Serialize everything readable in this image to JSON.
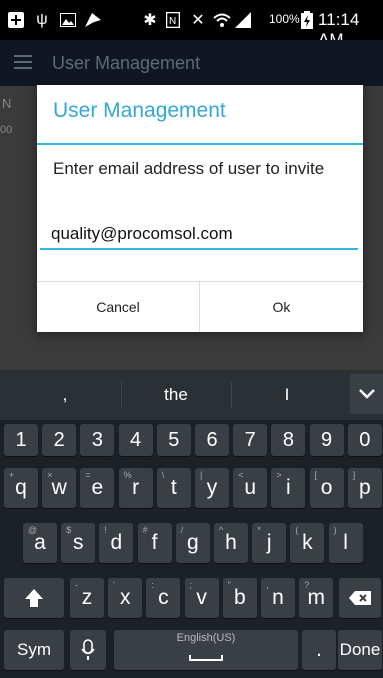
{
  "status_bar": {
    "icons": [
      "add-icon",
      "usb-icon",
      "image-icon",
      "speed-icon",
      "bluetooth-icon",
      "nfc-icon",
      "mute-icon",
      "wifi-icon",
      "signal-icon",
      "battery-icon"
    ],
    "battery_pct": "100%",
    "time": "11:14 AM"
  },
  "app": {
    "title": "User Management",
    "column_header": "N",
    "row_value": "00"
  },
  "dialog": {
    "title": "User Management",
    "message": "Enter email address of user to invite",
    "email_value": "quality@procomsol.com",
    "cancel_label": "Cancel",
    "ok_label": "Ok",
    "accent_color": "#33b5e5"
  },
  "keyboard": {
    "suggestions": [
      ",",
      "the",
      "I"
    ],
    "number_row": [
      "1",
      "2",
      "3",
      "4",
      "5",
      "6",
      "7",
      "8",
      "9",
      "0"
    ],
    "row1": [
      {
        "key": "q",
        "sub": "+"
      },
      {
        "key": "w",
        "sub": "×"
      },
      {
        "key": "e",
        "sub": "="
      },
      {
        "key": "r",
        "sub": "%"
      },
      {
        "key": "t",
        "sub": "\\"
      },
      {
        "key": "y",
        "sub": "|"
      },
      {
        "key": "u",
        "sub": "<"
      },
      {
        "key": "i",
        "sub": ">"
      },
      {
        "key": "o",
        "sub": "["
      },
      {
        "key": "p",
        "sub": "]"
      }
    ],
    "row2": [
      {
        "key": "a",
        "sub": "@"
      },
      {
        "key": "s",
        "sub": "$"
      },
      {
        "key": "d",
        "sub": "!"
      },
      {
        "key": "f",
        "sub": "#"
      },
      {
        "key": "g",
        "sub": "/"
      },
      {
        "key": "h",
        "sub": "^"
      },
      {
        "key": "j",
        "sub": "*"
      },
      {
        "key": "k",
        "sub": "("
      },
      {
        "key": "l",
        "sub": ")"
      }
    ],
    "row3": [
      {
        "key": "z",
        "sub": "-"
      },
      {
        "key": "x",
        "sub": "'"
      },
      {
        "key": "c",
        "sub": ":"
      },
      {
        "key": "v",
        "sub": ";"
      },
      {
        "key": "b",
        "sub": "\""
      },
      {
        "key": "n",
        "sub": ","
      },
      {
        "key": "m",
        "sub": "?"
      }
    ],
    "sym_label": "Sym",
    "space_label": "English(US)",
    "period_label": ".",
    "done_label": "Done"
  }
}
